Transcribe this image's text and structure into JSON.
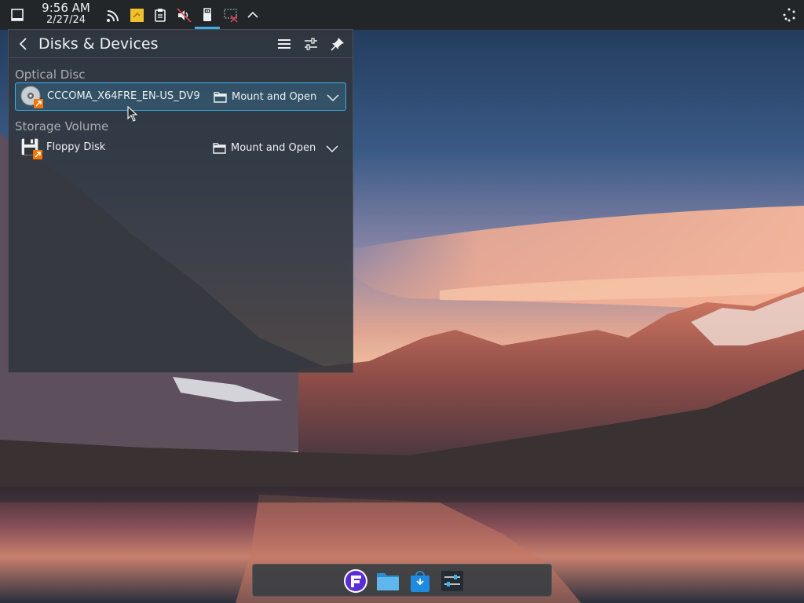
{
  "panel": {
    "clock_time": "9:56 AM",
    "clock_date": "2/27/24",
    "tray_icons": [
      "rss-icon",
      "sticky-note-icon",
      "clipboard-icon",
      "volume-muted-icon",
      "usb-drive-icon",
      "display-disconnected-icon",
      "chevron-up-icon"
    ],
    "accent": "#3daee9"
  },
  "popup": {
    "title": "Disks & Devices",
    "sections": [
      {
        "title": "Optical Disc",
        "devices": [
          {
            "name": "CCCOMA_X64FRE_EN-US_DV9",
            "action_label": "Mount and Open",
            "icon": "optical-disc-icon"
          }
        ]
      },
      {
        "title": "Storage Volume",
        "devices": [
          {
            "name": "Floppy Disk",
            "action_label": "Mount and Open",
            "icon": "floppy-disk-icon"
          }
        ]
      }
    ]
  },
  "dock": {
    "items": [
      "app-launcher-icon",
      "file-manager-icon",
      "app-store-icon",
      "system-settings-icon"
    ]
  }
}
